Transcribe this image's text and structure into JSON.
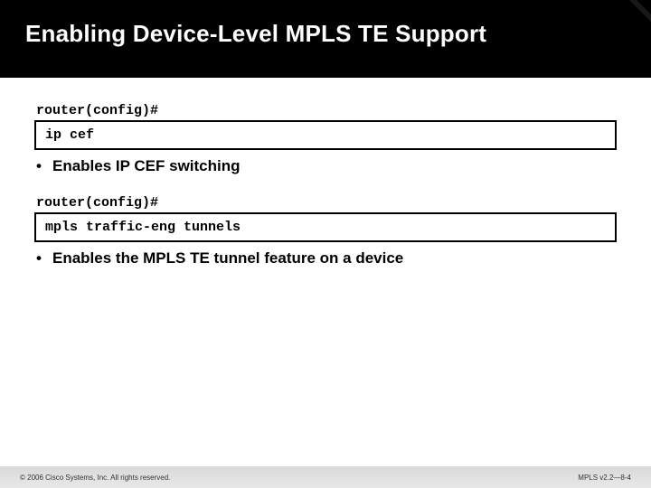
{
  "title": "Enabling Device-Level MPLS TE Support",
  "block1": {
    "prompt": "router(config)#",
    "command": "ip cef",
    "bullet": "Enables IP CEF switching"
  },
  "block2": {
    "prompt": "router(config)#",
    "command": "mpls traffic-eng tunnels",
    "bullet": "Enables the MPLS TE tunnel feature on a device"
  },
  "footer": {
    "copyright": "© 2006 Cisco Systems, Inc. All rights reserved.",
    "pageref": "MPLS v2.2—8-4"
  }
}
